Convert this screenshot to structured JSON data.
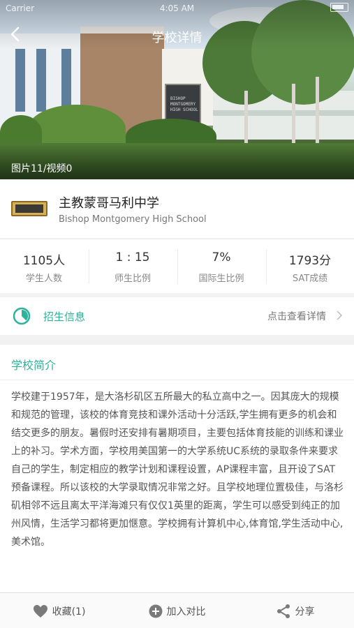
{
  "status_bar": {
    "carrier": "Carrier",
    "time": "4:05 AM"
  },
  "header": {
    "title": "学校详情"
  },
  "hero": {
    "photo_count": "图片11/视频0",
    "sign_text": "BISHOP\nMONTGOMERY\nHIGH SCHOOL"
  },
  "school": {
    "name_cn": "主教蒙哥马利中学",
    "name_en": "Bishop Montgomery High School"
  },
  "stats": [
    {
      "value": "1105人",
      "label": "学生人数"
    },
    {
      "value": "1 : 15",
      "label": "师生比例"
    },
    {
      "value": "7%",
      "label": "国际生比例"
    },
    {
      "value": "1793分",
      "label": "SAT成绩"
    }
  ],
  "enroll": {
    "label": "招生信息",
    "link": "点击查看详情"
  },
  "intro": {
    "title": "学校简介",
    "text": "学校建于1957年，是大洛杉矶区五所最大的私立高中之一。因其庞大的规模和规范的管理，该校的体育竞技和课外活动十分活跃,学生拥有更多的机会和结交更多的朋友。暑假时还安排有暑期项目，主要包括体育技能的训练和课业上的补习。学术方面，学校用美国第一的大学系统UC系统的录取条件来要求自己的学生，制定相应的教学计划和课程设置，AP课程丰富，且开设了SAT预备课程。所以该校的大学录取情况非常之好。且学校地理位置极佳，与洛杉矶相邻不远且离太平洋海滩只有仅仅1英里的距离，学生可以感受到纯正的加州风情，生活学习都将更加惬意。学校拥有计算机中心,体育馆,学生活动中心,美术馆。"
  },
  "tabbar": {
    "favorite": "收藏(1)",
    "compare": "加入对比",
    "share": "分享"
  },
  "colors": {
    "accent": "#2bb39c"
  },
  "icons": [
    "back-arrow-icon",
    "pie-chart-icon",
    "chevron-right-icon",
    "heart-icon",
    "plus-circle-icon",
    "share-icon"
  ]
}
